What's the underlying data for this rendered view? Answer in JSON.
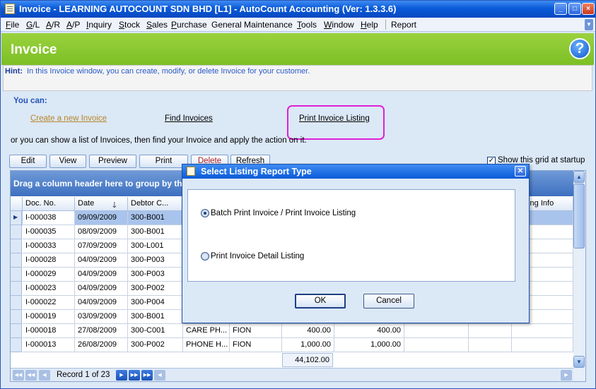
{
  "window": {
    "title": "Invoice - LEARNING AUTOCOUNT SDN BHD [L1] - AutoCount Accounting (Ver: 1.3.3.6)",
    "controls": [
      "_",
      "□",
      "×"
    ]
  },
  "menu": [
    {
      "label": "File",
      "mnemonic": "F",
      "rest": "ile"
    },
    {
      "label": "G/L",
      "mnemonic": "G",
      "rest": "/L"
    },
    {
      "label": "A/R",
      "mnemonic": "A",
      "rest": "/R"
    },
    {
      "label": "A/P",
      "mnemonic": "A",
      "rest": "/P"
    },
    {
      "label": "Inquiry",
      "mnemonic": "I",
      "rest": "nquiry"
    },
    {
      "label": "Stock",
      "mnemonic": "S",
      "rest": "tock"
    },
    {
      "label": "Sales",
      "mnemonic": "S",
      "rest": "ales"
    },
    {
      "label": "Purchase",
      "mnemonic": "P",
      "rest": "urchase"
    },
    {
      "label": "General Maintenance",
      "mnemonic": "",
      "rest": "General Maintenance"
    },
    {
      "label": "Tools",
      "mnemonic": "T",
      "rest": "ools"
    },
    {
      "label": "Window",
      "mnemonic": "W",
      "rest": "indow"
    },
    {
      "label": "Help",
      "mnemonic": "H",
      "rest": "elp"
    },
    {
      "label": "Report",
      "mnemonic": "",
      "rest": "Report"
    }
  ],
  "header": {
    "title": "Invoice",
    "help_icon": "?"
  },
  "hint": {
    "label": "Hint:",
    "text": "In this Invoice window, you can create, modify, or delete Invoice for your customer."
  },
  "you_can": "You can:",
  "links": {
    "create": "Create a new Invoice",
    "find": "Find Invoices",
    "print_listing": "Print Invoice Listing"
  },
  "or_line": "or you can show a list of Invoices, then find your Invoice and apply the action on it.",
  "toolbar": {
    "edit": "Edit",
    "view": "View",
    "preview": "Preview",
    "print": "Print",
    "delete": "Delete",
    "refresh": "Refresh",
    "show_grid": "Show this grid at startup",
    "show_grid_checked": true
  },
  "grid": {
    "group_panel": "Drag a column header here to group by th",
    "columns": [
      "Doc. No.",
      "Date",
      "Debtor C...",
      "",
      "",
      "",
      "",
      "",
      "",
      "ping Info"
    ],
    "rows": [
      [
        "I-000038",
        "09/09/2009",
        "300-B001",
        "",
        "",
        "",
        ""
      ],
      [
        "I-000035",
        "08/09/2009",
        "300-B001",
        "",
        "",
        "",
        ""
      ],
      [
        "I-000033",
        "07/09/2009",
        "300-L001",
        "",
        "",
        "",
        ""
      ],
      [
        "I-000028",
        "04/09/2009",
        "300-P003",
        "",
        "",
        "",
        ""
      ],
      [
        "I-000029",
        "04/09/2009",
        "300-P003",
        "",
        "",
        "",
        ""
      ],
      [
        "I-000023",
        "04/09/2009",
        "300-P002",
        "",
        "",
        "",
        ""
      ],
      [
        "I-000022",
        "04/09/2009",
        "300-P004",
        "",
        "",
        "",
        ""
      ],
      [
        "I-000019",
        "03/09/2009",
        "300-B001",
        "",
        "",
        "",
        ""
      ],
      [
        "I-000018",
        "27/08/2009",
        "300-C001",
        "CARE PH...",
        "FION",
        "400.00",
        "400.00"
      ],
      [
        "I-000013",
        "26/08/2009",
        "300-P002",
        "PHONE H...",
        "FION",
        "1,000.00",
        "1,000.00"
      ]
    ],
    "total": "44,102.00",
    "record_text": "Record 1 of 23"
  },
  "dialog": {
    "title": "Select Listing Report Type",
    "option1": "Batch Print Invoice / Print Invoice Listing",
    "option2": "Print Invoice Detail Listing",
    "selected": 1,
    "ok": "OK",
    "cancel": "Cancel"
  }
}
